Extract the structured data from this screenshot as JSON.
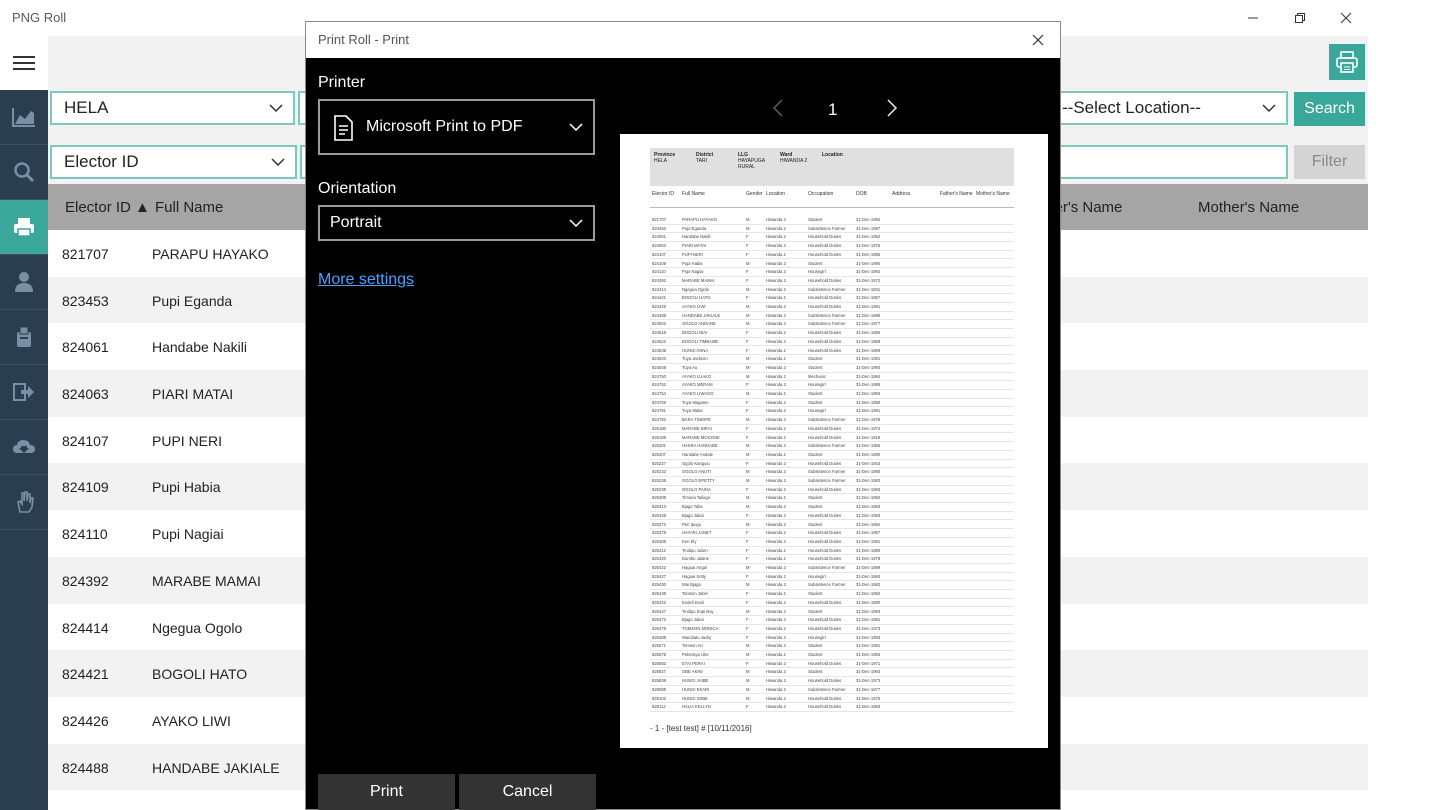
{
  "window": {
    "title": "PNG Roll"
  },
  "filters": {
    "province_value": "HELA",
    "location_placeholder": "--Select Location--",
    "search_label": "Search",
    "filter_field_value": "Elector ID",
    "filter_label": "Filter"
  },
  "table": {
    "columns": {
      "elector_id": "Elector ID",
      "sort_indicator": "▲",
      "full_name": "Full Name",
      "fathers_name": "ther's Name",
      "mothers_name": "Mother's Name"
    },
    "rows": [
      {
        "id": "821707",
        "name": "PARAPU HAYAKO"
      },
      {
        "id": "823453",
        "name": "Pupi Eganda"
      },
      {
        "id": "824061",
        "name": "Handabe Nakili"
      },
      {
        "id": "824063",
        "name": "PIARI MATAI"
      },
      {
        "id": "824107",
        "name": "PUPI NERI"
      },
      {
        "id": "824109",
        "name": "Pupi Habia"
      },
      {
        "id": "824110",
        "name": "Pupi Nagiai"
      },
      {
        "id": "824392",
        "name": "MARABE MAMAI"
      },
      {
        "id": "824414",
        "name": "Ngegua Ogolo"
      },
      {
        "id": "824421",
        "name": "BOGOLI HATO"
      },
      {
        "id": "824426",
        "name": "AYAKO LIWI"
      },
      {
        "id": "824488",
        "name": "HANDABE JAKIALE"
      }
    ]
  },
  "print_dialog": {
    "title": "Print Roll - Print",
    "printer_label": "Printer",
    "printer_value": "Microsoft Print to PDF",
    "orientation_label": "Orientation",
    "orientation_value": "Portrait",
    "more_settings": "More settings",
    "print_button": "Print",
    "cancel_button": "Cancel",
    "page_number": "1"
  },
  "preview": {
    "header": {
      "province_label": "Province",
      "province_value": "HELA",
      "district_label": "District",
      "district_value": "TARI",
      "llg_label": "LLG",
      "llg_value": "HAYAPUGA RURAL",
      "ward_label": "Ward",
      "ward_value": "HIWANDA 2",
      "location_label": "Location"
    },
    "columns": [
      "Elector ID",
      "Full Name",
      "Gender",
      "Location",
      "Occupation",
      "DOB",
      "Address",
      "Father's Name",
      "Mother's Name"
    ],
    "rows": [
      [
        "821707",
        "PARAPU HAYAKO",
        "M",
        "Hiwanda 2",
        "Student",
        "31-Dec-1992"
      ],
      [
        "823453",
        "Pupi Eganda",
        "M",
        "Hiwanda 2",
        "Subsistence Farmer",
        "31-Dec-1987"
      ],
      [
        "824061",
        "Handabe Nakili",
        "F",
        "Hiwanda 2",
        "Household Duties",
        "31-Dec-1982"
      ],
      [
        "824063",
        "PIARI MATAI",
        "F",
        "Hiwanda 2",
        "Household Duties",
        "31-Dec-1975"
      ],
      [
        "824107",
        "PUPI NERI",
        "F",
        "Hiwanda 2",
        "Household Duties",
        "31-Dec-1985"
      ],
      [
        "824109",
        "Pupi Habia",
        "M",
        "Hiwanda 2",
        "Student",
        "31-Dec-1990"
      ],
      [
        "824110",
        "Pupi Nagiai",
        "F",
        "Hiwanda 2",
        "Housegirl",
        "31-Dec-1992"
      ],
      [
        "824392",
        "MARABE MAMAI",
        "F",
        "Hiwanda 2",
        "Household Duties",
        "31-Dec-1972"
      ],
      [
        "824414",
        "Ngegua Ogolo",
        "M",
        "Hiwanda 2",
        "Subsistence Farmer",
        "31-Dec-1931"
      ],
      [
        "824421",
        "BOGOLI HATO",
        "F",
        "Hiwanda 2",
        "Household Duties",
        "31-Dec-1957"
      ],
      [
        "824426",
        "AYAKO LIWI",
        "M",
        "Hiwanda 2",
        "Household Duties",
        "31-Dec-1981"
      ],
      [
        "824488",
        "HANDABE JAKIALE",
        "M",
        "Hiwanda 2",
        "Subsistence Farmer",
        "31-Dec-1985"
      ],
      [
        "824503",
        "OGOLO ANDANE",
        "M",
        "Hiwanda 2",
        "Subsistence Farmer",
        "31-Dec-1977"
      ],
      [
        "824518",
        "BOGOLI IBAI",
        "F",
        "Hiwanda 2",
        "Household Duties",
        "31-Dec-1955"
      ],
      [
        "824522",
        "BOGOLI TIMBAME",
        "F",
        "Hiwanda 2",
        "Household Duties",
        "31-Dec-1959"
      ],
      [
        "824538",
        "HUNGI ANNA",
        "F",
        "Hiwanda 2",
        "Household Duties",
        "31-Dec-1969"
      ],
      [
        "824543",
        "Tuya Jackson",
        "M",
        "Hiwanda 2",
        "Student",
        "31-Dec-1981"
      ],
      [
        "824548",
        "Tuya Au",
        "M",
        "Hiwanda 2",
        "Student",
        "31-Dec-1993"
      ],
      [
        "824750",
        "AYAKO LUAKO",
        "M",
        "Hiwanda 2",
        "Mechanic",
        "31-Dec-1984"
      ],
      [
        "824752",
        "AYAKO MERAM",
        "F",
        "Hiwanda 2",
        "Housegirl",
        "31-Dec-1988"
      ],
      [
        "824754",
        "AYAKO LIWAGO",
        "M",
        "Hiwanda 2",
        "Student",
        "31-Dec-1993"
      ],
      [
        "824759",
        "Tuya Magame",
        "F",
        "Hiwanda 2",
        "Student",
        "31-Dec-1990"
      ],
      [
        "824781",
        "Tuya Matai",
        "F",
        "Hiwanda 2",
        "Housegirl",
        "31-Dec-1981"
      ],
      [
        "824782",
        "BARA TINDIPE",
        "M",
        "Hiwanda 2",
        "Subsistence Farmer",
        "31-Dec-1978"
      ],
      [
        "825180",
        "MARABE BIRAI",
        "F",
        "Hiwanda 2",
        "Household Duties",
        "31-Dec-1974"
      ],
      [
        "825188",
        "MARABE MOGONE",
        "F",
        "Hiwanda 2",
        "Household Duties",
        "31-Dec-1919"
      ],
      [
        "825201",
        "HAKRA HANDABE",
        "M",
        "Hiwanda 2",
        "Subsistence Farmer",
        "31-Dec-1966"
      ],
      [
        "825207",
        "Handabe Andale",
        "M",
        "Hiwanda 2",
        "Student",
        "31-Dec-1990"
      ],
      [
        "825227",
        "Ogolo Kanguiu",
        "F",
        "Hiwanda 2",
        "Household Duties",
        "31-Dec-1943"
      ],
      [
        "825233",
        "OGOLO ANUTI",
        "M",
        "Hiwanda 2",
        "Subsistence Farmer",
        "31-Dec-1980"
      ],
      [
        "825235",
        "OGOLO EPETTY",
        "M",
        "Hiwanda 2",
        "Subsistence Farmer",
        "31-Dec-1983"
      ],
      [
        "825238",
        "OGOLO PAINA",
        "F",
        "Hiwanda 2",
        "Household Duties",
        "31-Dec-1983"
      ],
      [
        "825308",
        "Timuria Tailago",
        "M",
        "Hiwanda 2",
        "Student",
        "31-Dec-1992"
      ],
      [
        "825313",
        "Bjago Tabe",
        "M",
        "Hiwanda 2",
        "Student",
        "31-Dec-1983"
      ],
      [
        "825348",
        "Bjago Jakai",
        "F",
        "Hiwanda 2",
        "Household Duties",
        "31-Dec-1983"
      ],
      [
        "825373",
        "Peri Ipugu",
        "M",
        "Hiwanda 2",
        "Student",
        "31-Dec-1992"
      ],
      [
        "825378",
        "HAYARI JANET",
        "F",
        "Hiwanda 2",
        "Household Duties",
        "31-Dec-1957"
      ],
      [
        "825406",
        "Ken Ely",
        "F",
        "Hiwanda 2",
        "Household Duties",
        "31-Dec-1981"
      ],
      [
        "825412",
        "Tindipu Julien",
        "F",
        "Hiwanda 2",
        "Household Duties",
        "31-Dec-1980"
      ],
      [
        "825420",
        "Dumbu Jalane",
        "F",
        "Hiwanda 2",
        "Household Duties",
        "31-Dec-1978"
      ],
      [
        "825422",
        "Haguai Angai",
        "M",
        "Hiwanda 2",
        "Subsistence Farmer",
        "31-Dec-1989"
      ],
      [
        "825427",
        "Haguai Sotty",
        "F",
        "Hiwanda 2",
        "Housegirl",
        "31-Dec-1993"
      ],
      [
        "825430",
        "Wai Bjago",
        "M",
        "Hiwanda 2",
        "Subsistence Farmer",
        "31-Dec-1982"
      ],
      [
        "825438",
        "Tomson Jabiri",
        "F",
        "Hiwanda 2",
        "Student",
        "31-Dec-1992"
      ],
      [
        "825442",
        "Endeli Kiruli",
        "F",
        "Hiwanda 2",
        "Household Duties",
        "31-Dec-1980"
      ],
      [
        "825447",
        "Tindipu Kopi Boy",
        "M",
        "Hiwanda 2",
        "Student",
        "31-Dec-1993"
      ],
      [
        "825473",
        "Bjago Jakai",
        "F",
        "Hiwanda 2",
        "Household Duties",
        "31-Dec-1981"
      ],
      [
        "825478",
        "TOMSON MONICA",
        "F",
        "Hiwanda 2",
        "Household Duties",
        "31-Dec-1973"
      ],
      [
        "825488",
        "Wandiatu Jacky",
        "F",
        "Hiwanda 2",
        "Housegirl",
        "31-Dec-1993"
      ],
      [
        "825571",
        "Tomson Ari",
        "M",
        "Hiwanda 2",
        "Student",
        "31-Dec-1981"
      ],
      [
        "825575",
        "Peberaya Ube",
        "M",
        "Hiwanda 2",
        "Student",
        "31-Dec-1983"
      ],
      [
        "825582",
        "ETAI PERAI",
        "F",
        "Hiwanda 2",
        "Household Duties",
        "31-Dec-1971"
      ],
      [
        "825827",
        "OBE AKINI",
        "M",
        "Hiwanda 2",
        "Student",
        "31-Dec-1993"
      ],
      [
        "825838",
        "HUNGI JAIBE",
        "M",
        "Hiwanda 2",
        "Household Duties",
        "31-Dec-1973"
      ],
      [
        "828088",
        "HUNGI EKARI",
        "M",
        "Hiwanda 2",
        "Subsistence Farmer",
        "31-Dec-1977"
      ],
      [
        "828102",
        "HUNGI IGIBE",
        "M",
        "Hiwanda 2",
        "Household Duties",
        "31-Dec-1975"
      ],
      [
        "828112",
        "HALIA KELLYN",
        "F",
        "Hiwanda 2",
        "Household Duties",
        "31-Dec-1983"
      ]
    ],
    "footer": "- 1 - [test test]  #  [10/11/2016]"
  }
}
